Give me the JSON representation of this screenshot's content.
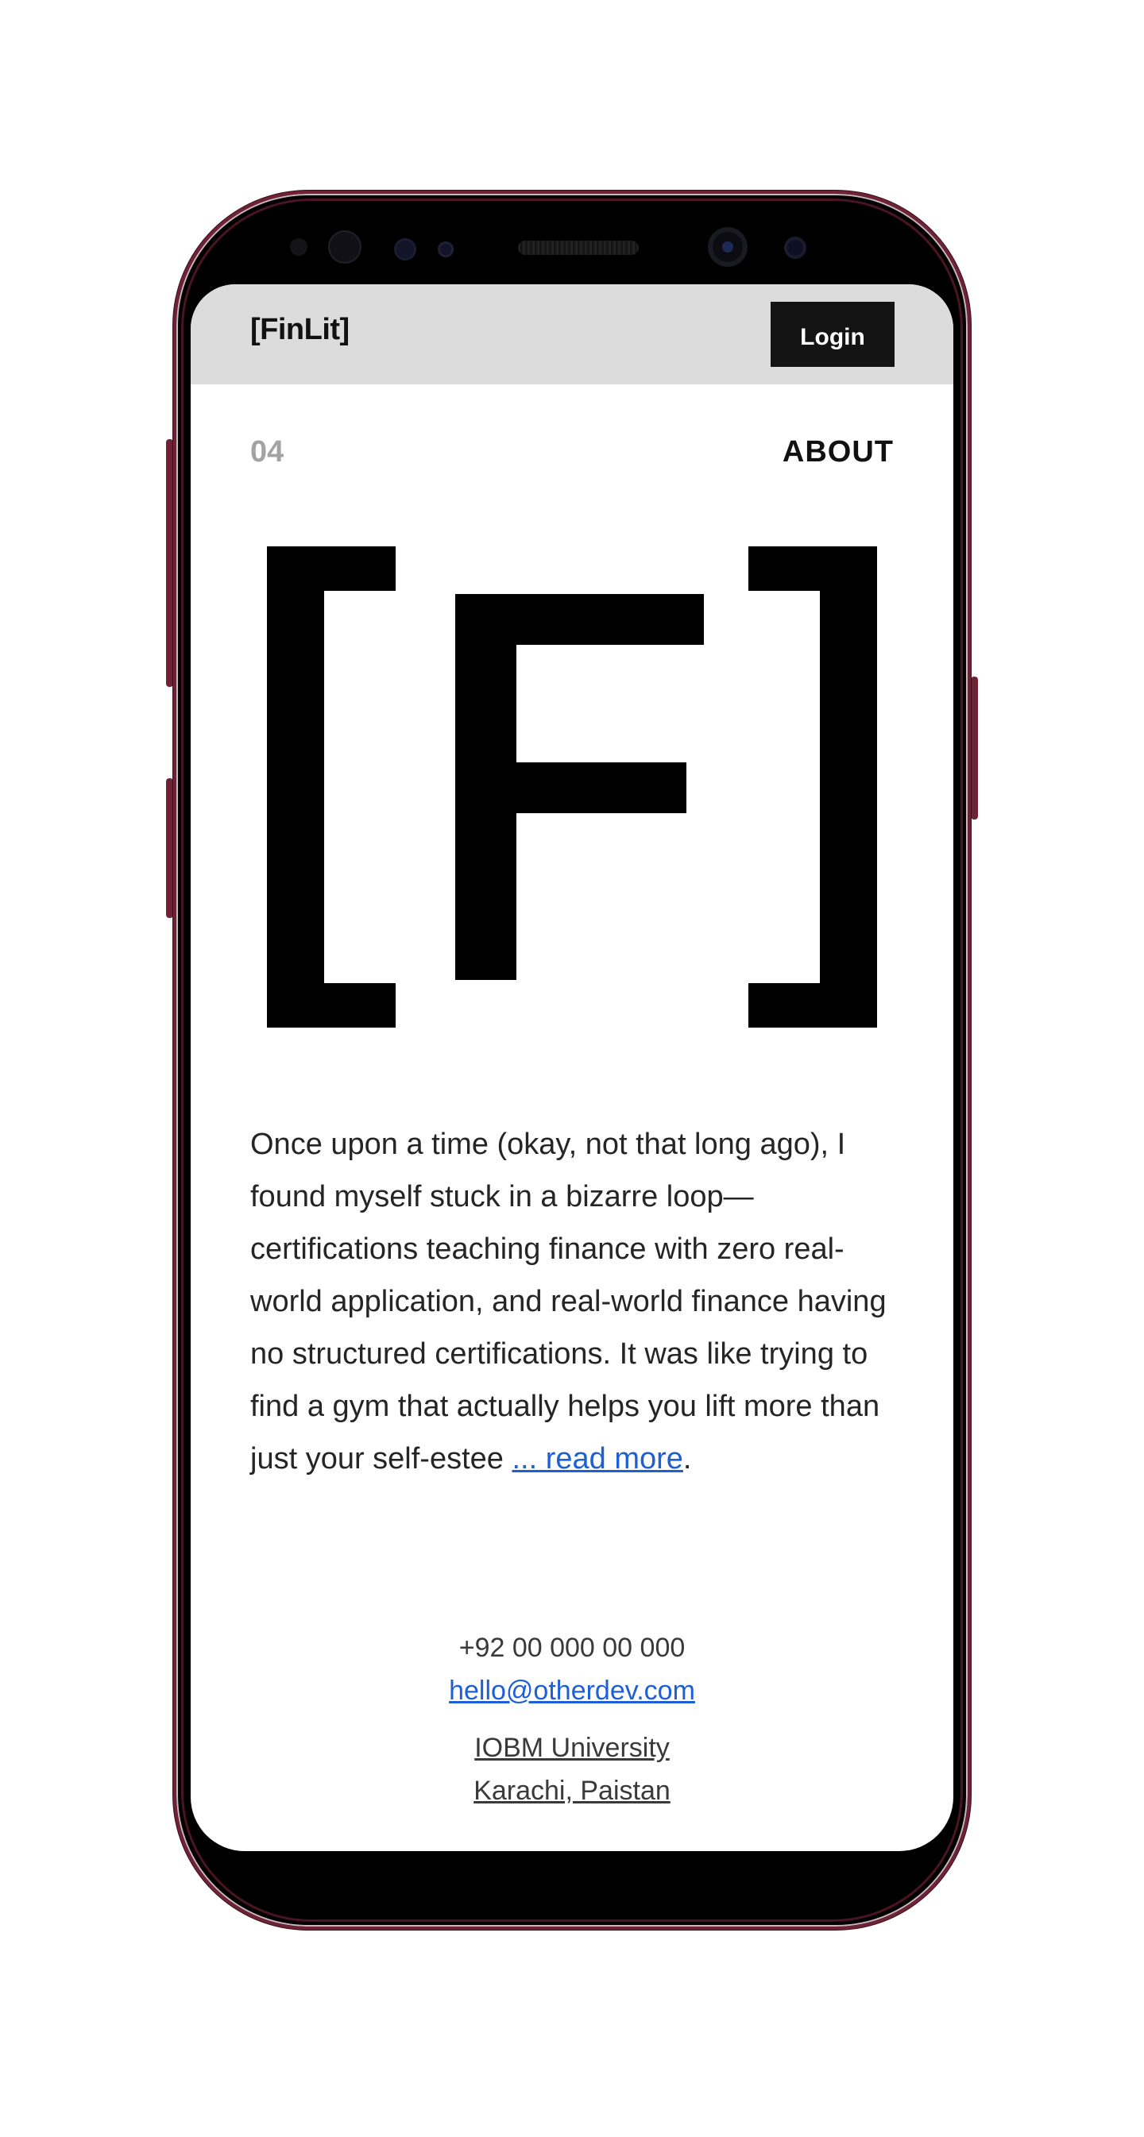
{
  "header": {
    "brand": "[FinLit]",
    "login_label": "Login"
  },
  "section": {
    "index": "04",
    "title": "ABOUT"
  },
  "logo": {
    "glyph": "[F]"
  },
  "about": {
    "body": "Once upon a time (okay, not that long ago), I found myself stuck in a bizarre loop—certifications teaching finance with zero real-world application, and real-world finance having no structured certifications. It was like trying to find a gym that actually helps you lift more than just your self-estee ",
    "read_more": "... read more",
    "trailing": "."
  },
  "contact": {
    "phone": "+92 00 000 00 000",
    "email": "hello@otherdev.com",
    "address_line1": "IOBM University",
    "address_line2": "Karachi, Paistan"
  },
  "colors": {
    "phone_frame": "#6e2236",
    "header_bg": "#dcdcdc",
    "login_bg": "#141414",
    "link": "#1f5fd6",
    "muted": "#a3a3a3"
  }
}
